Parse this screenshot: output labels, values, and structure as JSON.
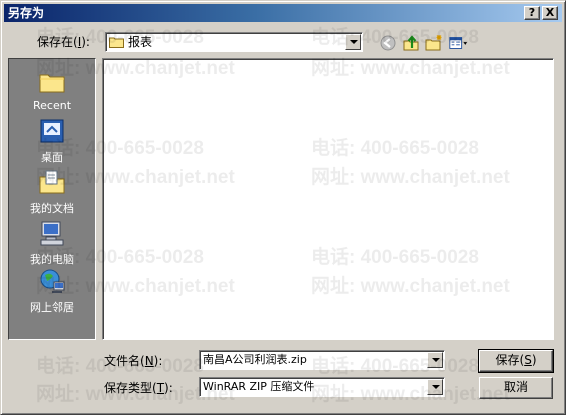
{
  "window": {
    "title": "另存为",
    "help_label": "?",
    "close_label": "X"
  },
  "save_in": {
    "label": "保存在(",
    "hotkey": "I",
    "label_suffix": "):",
    "folder": "报表"
  },
  "places": [
    {
      "label": "Recent",
      "icon": "recent-folder-icon"
    },
    {
      "label": "桌面",
      "icon": "desktop-icon"
    },
    {
      "label": "我的文档",
      "icon": "my-documents-icon"
    },
    {
      "label": "我的电脑",
      "icon": "my-computer-icon"
    },
    {
      "label": "网上邻居",
      "icon": "network-places-icon"
    }
  ],
  "filename": {
    "label": "文件名(",
    "hotkey": "N",
    "label_suffix": "):",
    "value": "南昌A公司利润表.zip"
  },
  "filetype": {
    "label": "保存类型(",
    "hotkey": "T",
    "label_suffix": "):",
    "value": "WinRAR ZIP 压缩文件"
  },
  "buttons": {
    "save": "保存(",
    "save_hotkey": "S",
    "save_suffix": ")",
    "cancel": "取消"
  },
  "watermark": {
    "phone": "电话: 400-665-0028",
    "site": "网址: www.chanjet.net"
  },
  "colors": {
    "title_start": "#0a246a",
    "title_end": "#a6caf0",
    "face": "#d4d0c8",
    "places_bg": "#808080"
  }
}
